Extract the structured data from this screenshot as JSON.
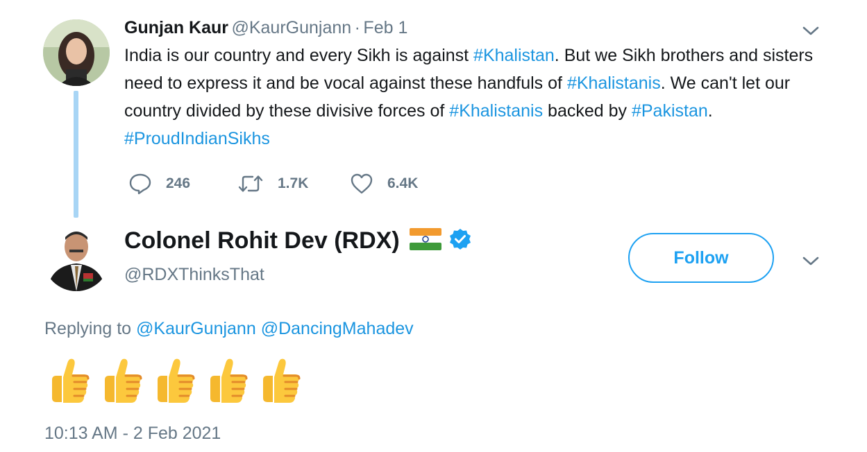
{
  "parent_tweet": {
    "author_name": "Gunjan Kaur",
    "author_handle": "@KaurGunjann",
    "separator": "·",
    "date": "Feb 1",
    "text": {
      "t1": "India is our country and every Sikh is against ",
      "h1": "#Khalistan",
      "t2": ". But we Sikh brothers and sisters need to express it and be vocal against these handfuls of ",
      "h2": "#Khalistanis",
      "t3": ". We can't let our country divided by these divisive forces of ",
      "h3": "#Khalistanis",
      "t4": " backed by ",
      "h4": "#Pakistan",
      "t5": ". ",
      "h5": "#ProudIndianSikhs"
    },
    "replies_count": "246",
    "retweets_count": "1.7K",
    "likes_count": "6.4K"
  },
  "reply_tweet": {
    "author_name": "Colonel Rohit Dev (RDX)",
    "author_handle": "@RDXThinksThat",
    "follow_label": "Follow",
    "replying_prefix": "Replying to",
    "replying_mention_1": "@KaurGunjann",
    "replying_mention_2": "@DancingMahadev",
    "emoji_count": 5,
    "timestamp": "10:13 AM - 2 Feb 2021"
  },
  "icons": {
    "reply": "speech-bubble-icon",
    "retweet": "retweet-icon",
    "like": "heart-icon",
    "more": "chevron-down-icon",
    "verified": "verified-badge-icon",
    "flag": "india-flag-icon",
    "thumbs": "thumbs-up-icon"
  },
  "colors": {
    "accent": "#1da1f2",
    "link": "#1b95e0",
    "muted": "#657786",
    "thread_line": "#a8d5f5"
  }
}
